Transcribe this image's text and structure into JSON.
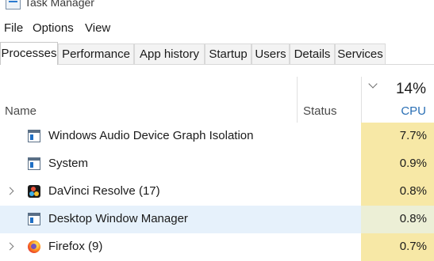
{
  "window": {
    "title": "Task Manager"
  },
  "menu": [
    "File",
    "Options",
    "View"
  ],
  "tabs": [
    {
      "label": "Processes",
      "active": true
    },
    {
      "label": "Performance",
      "active": false
    },
    {
      "label": "App history",
      "active": false
    },
    {
      "label": "Startup",
      "active": false
    },
    {
      "label": "Users",
      "active": false
    },
    {
      "label": "Details",
      "active": false
    },
    {
      "label": "Services",
      "active": false
    }
  ],
  "columns": {
    "name": "Name",
    "status": "Status",
    "cpu_total": "14%",
    "cpu": "CPU"
  },
  "processes": [
    {
      "name": "Windows Audio Device Graph Isolation",
      "icon": "window-app-icon",
      "expandable": false,
      "cpu": "7.7%",
      "selected": false
    },
    {
      "name": "System",
      "icon": "window-app-icon",
      "expandable": false,
      "cpu": "0.9%",
      "selected": false
    },
    {
      "name": "DaVinci Resolve (17)",
      "icon": "davinci-resolve-icon",
      "expandable": true,
      "cpu": "0.8%",
      "selected": false
    },
    {
      "name": "Desktop Window Manager",
      "icon": "window-app-icon",
      "expandable": false,
      "cpu": "0.8%",
      "selected": true
    },
    {
      "name": "Firefox (9)",
      "icon": "firefox-icon",
      "expandable": true,
      "cpu": "0.7%",
      "selected": false
    }
  ],
  "colors": {
    "cpu_heat": "#f7e8a6",
    "selected_row": "#e6f1fb",
    "cpu_header": "#2a6fb5"
  }
}
